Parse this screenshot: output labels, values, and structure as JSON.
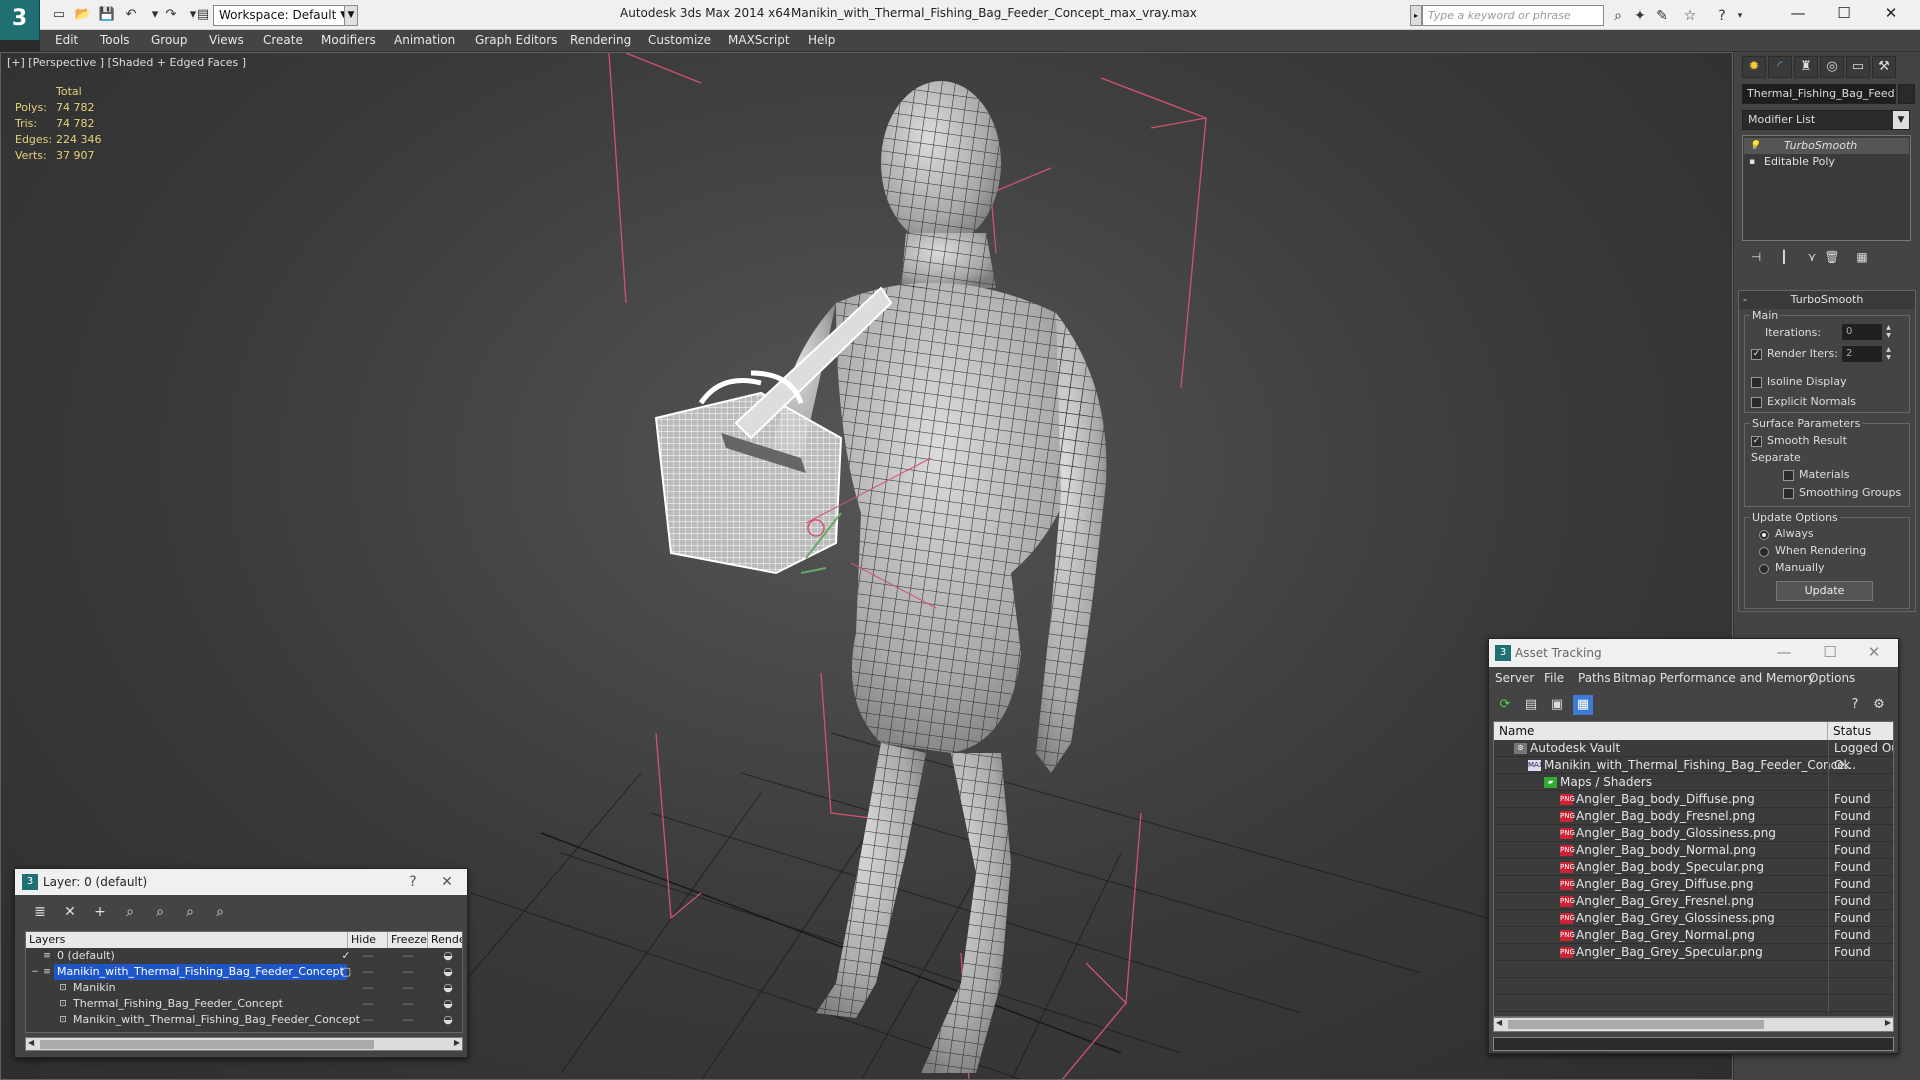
{
  "titlebar": {
    "workspace": "Workspace: Default",
    "app_title": "Autodesk 3ds Max  2014 x64",
    "file_title": "Manikin_with_Thermal_Fishing_Bag_Feeder_Concept_max_vray.max",
    "search_placeholder": "Type a keyword or phrase"
  },
  "menu": [
    "Edit",
    "Tools",
    "Group",
    "Views",
    "Create",
    "Modifiers",
    "Animation",
    "Graph Editors",
    "Rendering",
    "Customize",
    "MAXScript",
    "Help"
  ],
  "viewport": {
    "label": "[+] [Perspective ] [Shaded + Edged Faces ]",
    "stats_header": "Total",
    "stats": [
      {
        "label": "Polys:",
        "value": "74 782"
      },
      {
        "label": "Tris:",
        "value": "74 782"
      },
      {
        "label": "Edges:",
        "value": "224 346"
      },
      {
        "label": "Verts:",
        "value": "37 907"
      }
    ]
  },
  "command_panel": {
    "object_name": "Thermal_Fishing_Bag_Feeder",
    "modifier_list": "Modifier List",
    "stack": [
      "TurboSmooth",
      "Editable Poly"
    ],
    "rollout_title": "TurboSmooth",
    "main_group": "Main",
    "iterations_label": "Iterations:",
    "iterations_value": "0",
    "render_iters_label": "Render Iters:",
    "render_iters_value": "2",
    "isoline_label": "Isoline Display",
    "explicit_normals_label": "Explicit Normals",
    "surface_group": "Surface Parameters",
    "smooth_result_label": "Smooth Result",
    "separate_label": "Separate",
    "materials_label": "Materials",
    "smoothing_groups_label": "Smoothing Groups",
    "update_group": "Update Options",
    "always_label": "Always",
    "when_rendering_label": "When Rendering",
    "manually_label": "Manually",
    "update_button": "Update"
  },
  "layer_dialog": {
    "title": "Layer: 0 (default)",
    "help": "?",
    "columns": [
      "Layers",
      "Hide",
      "Freeze",
      "Render"
    ],
    "rows": [
      {
        "name": "0 (default)"
      },
      {
        "name": "Manikin_with_Thermal_Fishing_Bag_Feeder_Concept"
      },
      {
        "name": "Manikin"
      },
      {
        "name": "Thermal_Fishing_Bag_Feeder_Concept"
      },
      {
        "name": "Manikin_with_Thermal_Fishing_Bag_Feeder_Concept"
      }
    ]
  },
  "asset_tracking": {
    "title": "Asset Tracking",
    "menu": [
      "Server",
      "File",
      "Paths",
      "Bitmap Performance and Memory",
      "Options"
    ],
    "columns": [
      "Name",
      "Status"
    ],
    "rows": [
      {
        "name": "Autodesk Vault",
        "status": "Logged Out"
      },
      {
        "name": "Manikin_with_Thermal_Fishing_Bag_Feeder_Conce...",
        "status": "Ok"
      },
      {
        "name": "Maps / Shaders",
        "status": ""
      },
      {
        "name": "Angler_Bag_body_Diffuse.png",
        "status": "Found"
      },
      {
        "name": "Angler_Bag_body_Fresnel.png",
        "status": "Found"
      },
      {
        "name": "Angler_Bag_body_Glossiness.png",
        "status": "Found"
      },
      {
        "name": "Angler_Bag_body_Normal.png",
        "status": "Found"
      },
      {
        "name": "Angler_Bag_body_Specular.png",
        "status": "Found"
      },
      {
        "name": "Angler_Bag_Grey_Diffuse.png",
        "status": "Found"
      },
      {
        "name": "Angler_Bag_Grey_Fresnel.png",
        "status": "Found"
      },
      {
        "name": "Angler_Bag_Grey_Glossiness.png",
        "status": "Found"
      },
      {
        "name": "Angler_Bag_Grey_Normal.png",
        "status": "Found"
      },
      {
        "name": "Angler_Bag_Grey_Specular.png",
        "status": "Found"
      }
    ],
    "file_icon": "PNG"
  },
  "colors": {
    "accent": "#1f6f73",
    "selection": "#1e56c9",
    "stats_text": "#e6d17a",
    "bounding_box": "#d2536e"
  }
}
